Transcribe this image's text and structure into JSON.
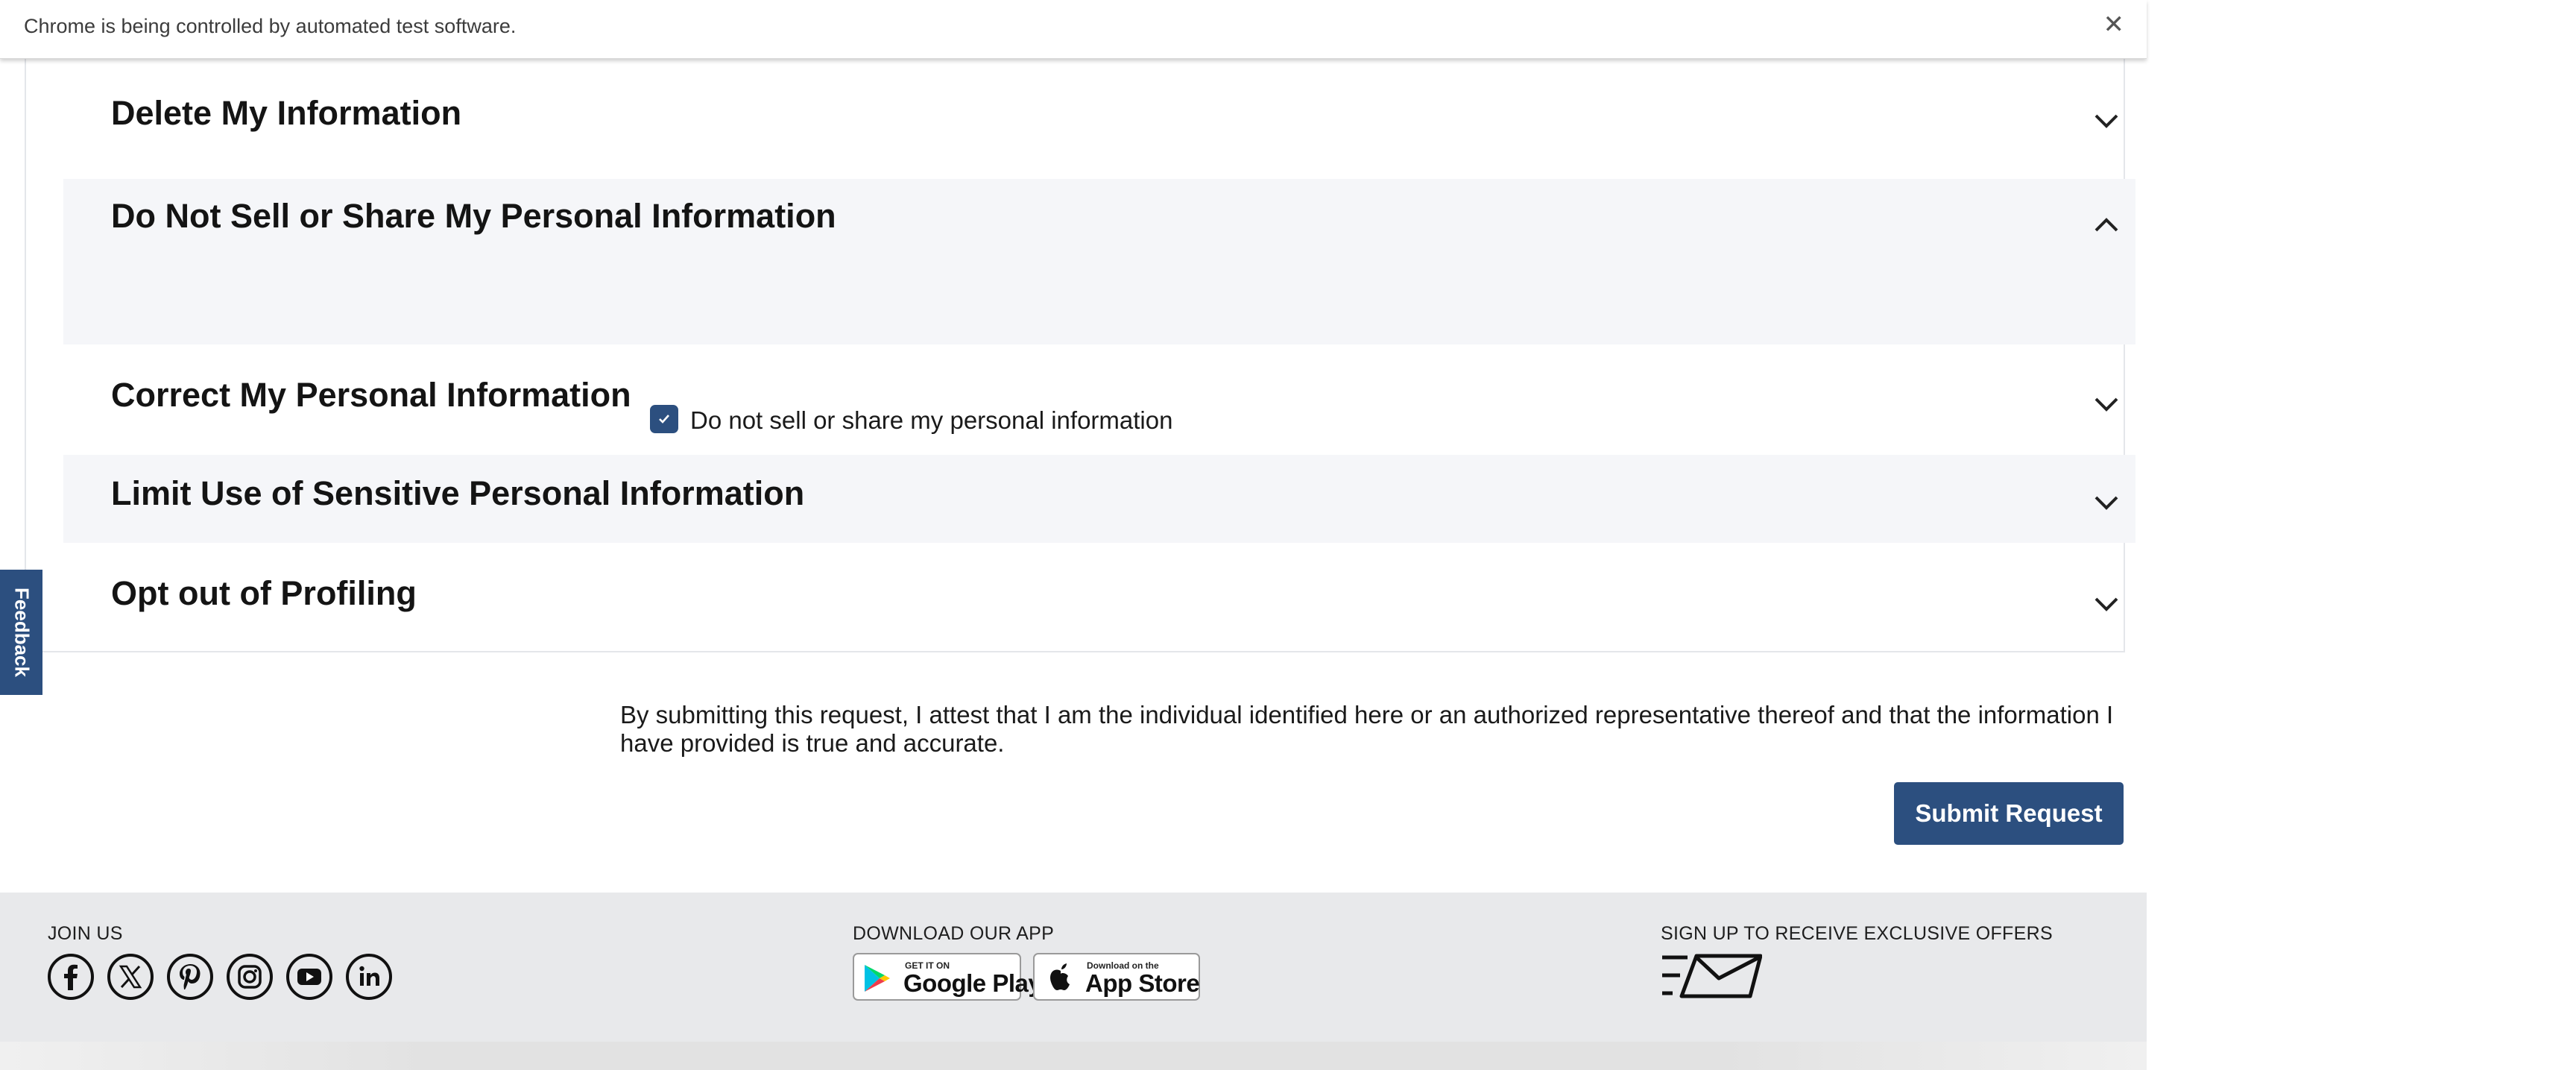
{
  "infobar": {
    "message": "Chrome is being controlled by automated test software.",
    "close_icon": "close-icon"
  },
  "sections": [
    {
      "title": "Delete My Information",
      "expanded": false
    },
    {
      "title": "Do Not Sell or Share My Personal Information",
      "expanded": true,
      "checkbox": {
        "label": "Do not sell or share my personal information",
        "checked": true
      }
    },
    {
      "title": "Correct My Personal Information",
      "expanded": false
    },
    {
      "title": "Limit Use of Sensitive Personal Information",
      "expanded": false
    },
    {
      "title": "Opt out of Profiling",
      "expanded": false
    }
  ],
  "feedback": {
    "label": "Feedback"
  },
  "attestation": "By submitting this request, I attest that I am the individual identified here or an authorized representative thereof and that the information I have provided is true and accurate.",
  "submit_label": "Submit Request",
  "footer": {
    "join_us": "JOIN US",
    "social_icons": [
      "facebook-icon",
      "x-icon",
      "pinterest-icon",
      "instagram-icon",
      "youtube-icon",
      "linkedin-icon"
    ],
    "download_app": "DOWNLOAD OUR APP",
    "google_play": {
      "small": "GET IT ON",
      "big": "Google Play"
    },
    "app_store": {
      "small": "Download on the",
      "big": "App Store"
    },
    "signup": "SIGN UP TO RECEIVE EXCLUSIVE OFFERS",
    "signup_icon": "envelope-icon"
  },
  "colors": {
    "primary": "#2c4f7f",
    "section_shade": "#f5f6f9",
    "footer_bg": "#e8e9eb"
  }
}
